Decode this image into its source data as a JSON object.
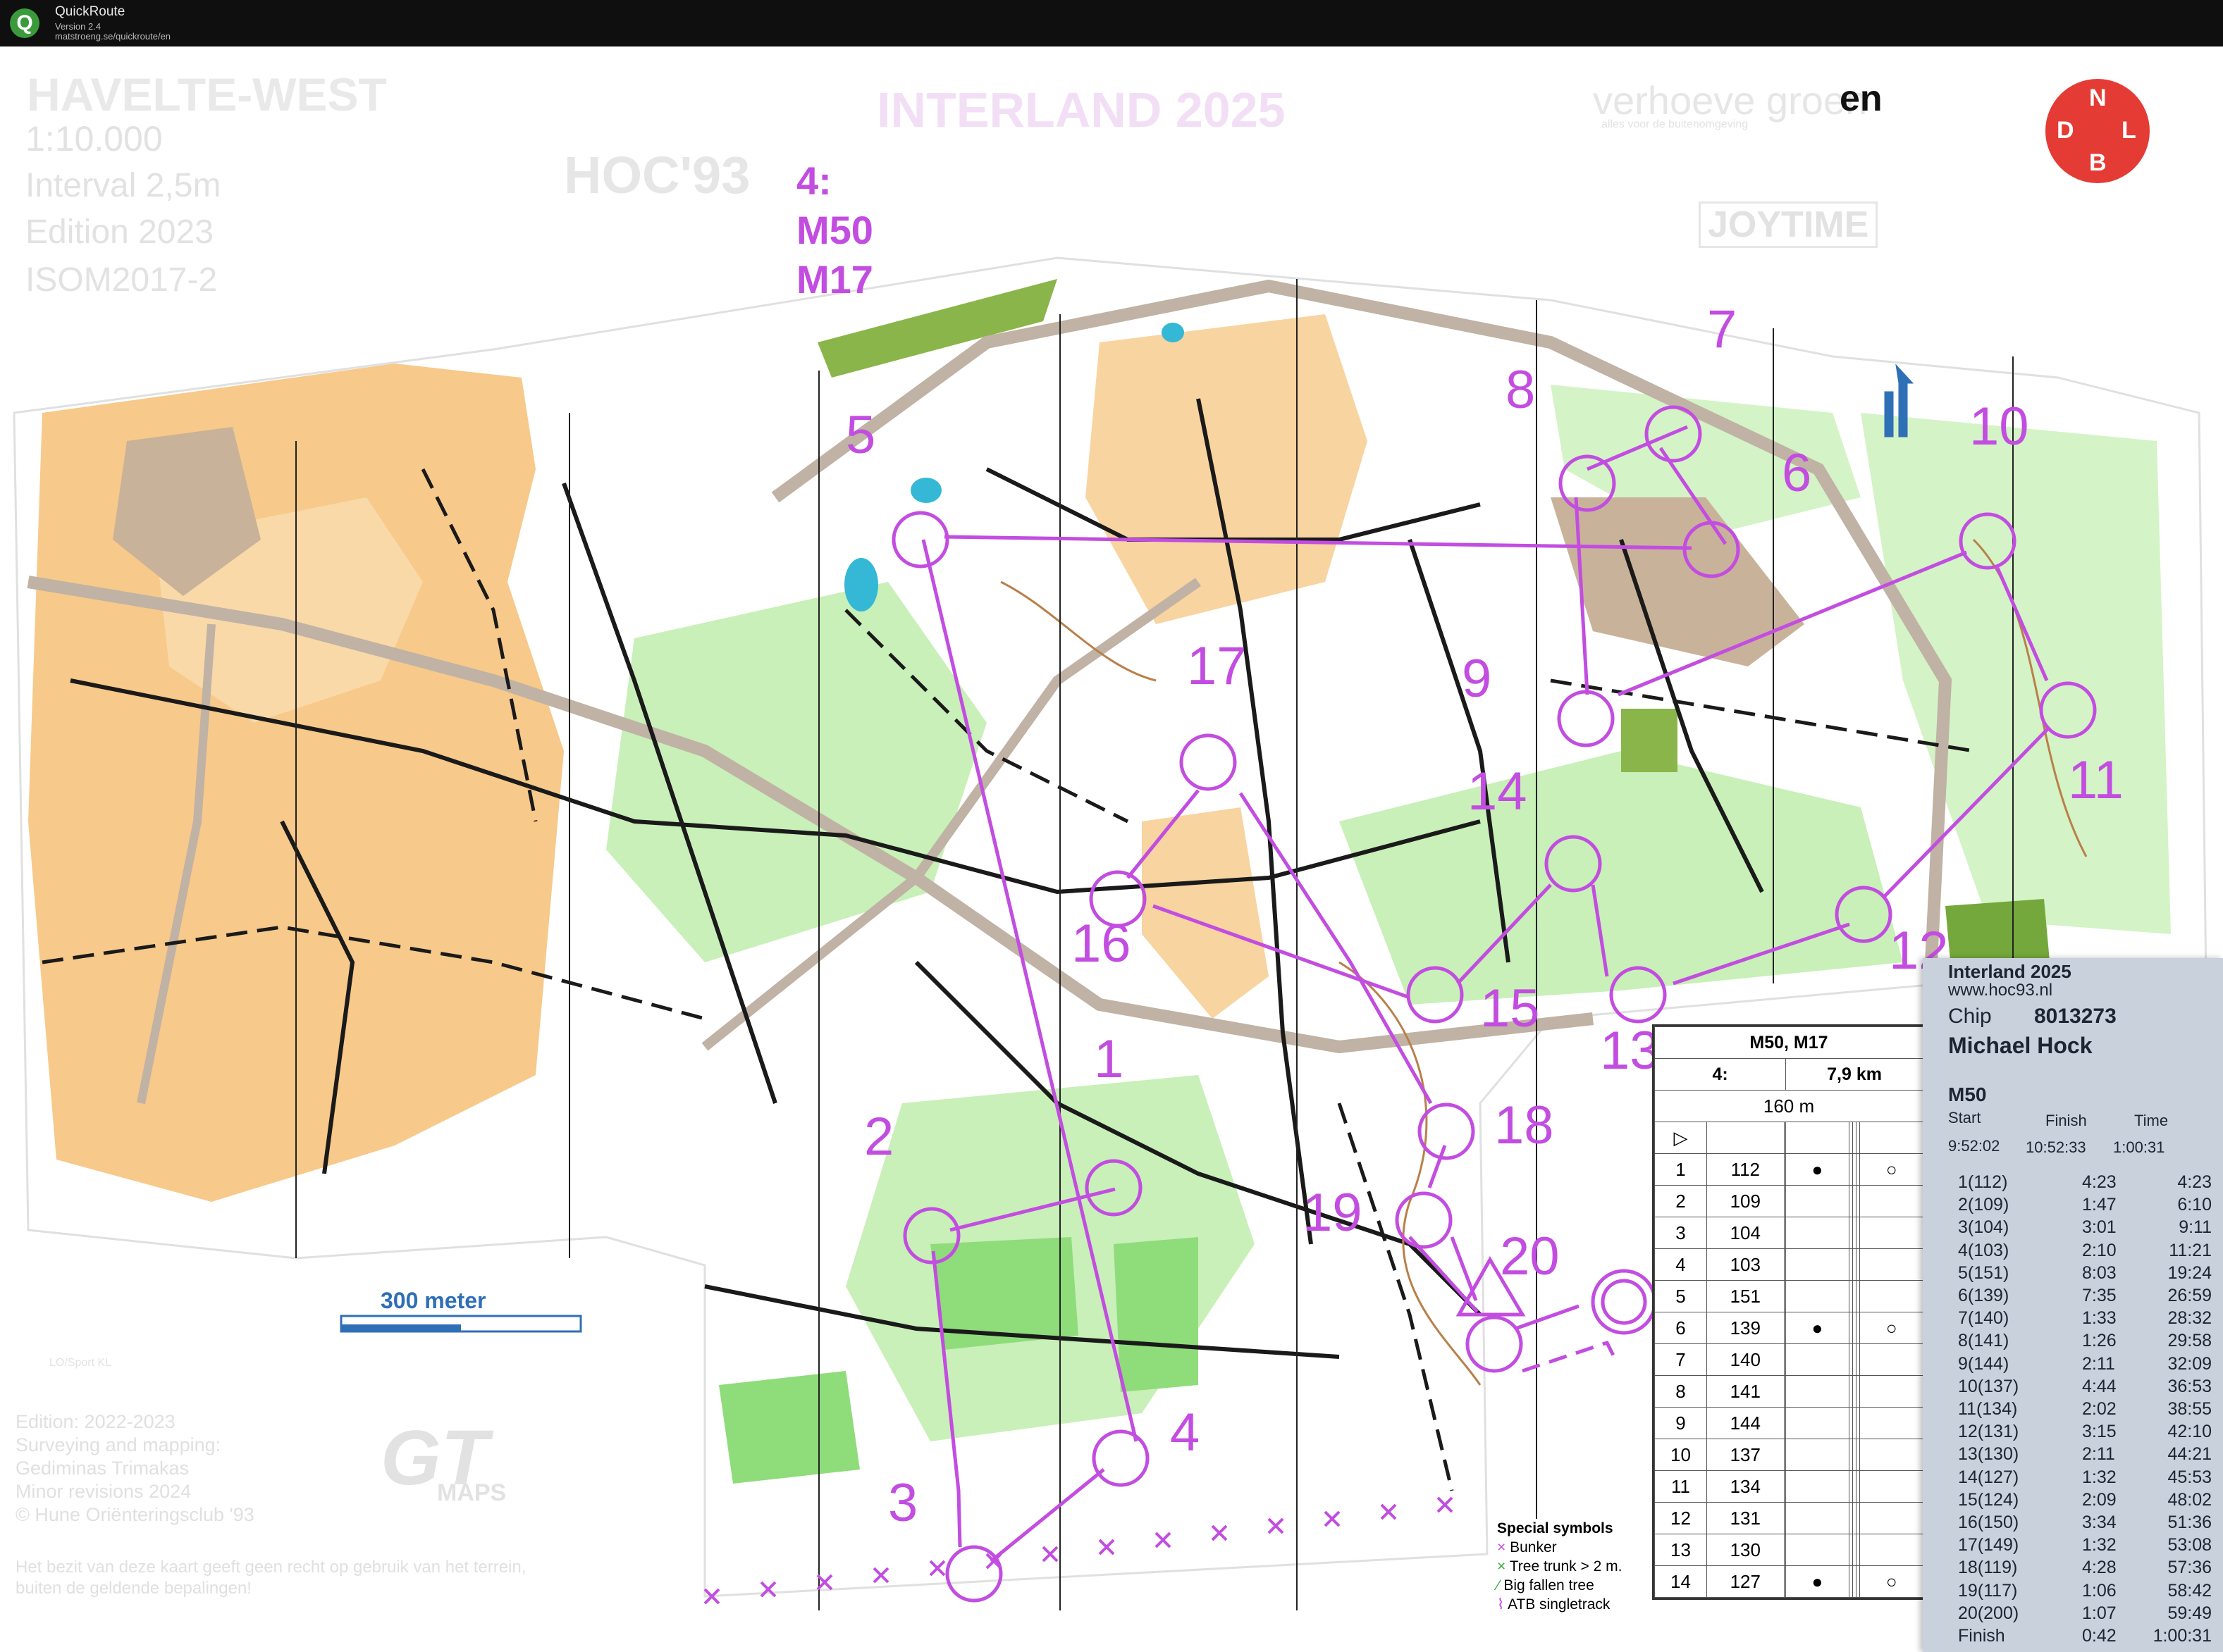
{
  "window": {
    "title": "QuickRoute",
    "version": "Version 2.4",
    "url": "matstroeng.se/quickroute/en"
  },
  "map": {
    "title": "HAVELTE-WEST",
    "scale": "1:10.000",
    "interval": "Interval 2,5m",
    "edition": "Edition 2023",
    "standard": "ISOM2017-2",
    "event_banner": "INTERLAND 2025",
    "sponsor": "verhoeve groen",
    "sponsor_tagline": "alles voor de buitenomgeving",
    "sponsor_suffix": "en",
    "sponsor2": "JOYTIME",
    "club_logo": "HOC'93",
    "class_label": [
      "4:",
      "M50",
      "M17"
    ],
    "scale_bar": "300 meter",
    "footer_lines": [
      "Edition: 2022-2023",
      "Surveying and mapping:",
      "Gediminas Trimakas",
      "Minor revisions 2024",
      "© Hune Oriënteringsclub '93"
    ],
    "disclaimer": [
      "Het bezit van deze kaart geeft geen recht op gebruik van het terrein,",
      "buiten de geldende bepalingen!"
    ],
    "logo_lo": "LO/Sport KL",
    "logo_gt": "GT",
    "logo_gt_sub": "MAPS",
    "flag_letters": [
      "N",
      "L",
      "D",
      "B"
    ],
    "controls": [
      {
        "label": "1"
      },
      {
        "label": "2"
      },
      {
        "label": "3"
      },
      {
        "label": "4"
      },
      {
        "label": "5"
      },
      {
        "label": "6"
      },
      {
        "label": "7"
      },
      {
        "label": "8"
      },
      {
        "label": "9"
      },
      {
        "label": "10"
      },
      {
        "label": "11"
      },
      {
        "label": "12"
      },
      {
        "label": "13"
      },
      {
        "label": "14"
      },
      {
        "label": "15"
      },
      {
        "label": "16"
      },
      {
        "label": "17"
      },
      {
        "label": "18"
      },
      {
        "label": "19"
      },
      {
        "label": "20"
      }
    ],
    "colors": {
      "course": "#c24de0",
      "open": "#f7c98a",
      "forest_green": "#8fdc7a",
      "light_green": "#c8f0b8",
      "track": "#1a1a1a",
      "contour": "#b9804a",
      "paved": "#c9b29a",
      "water": "#35b8d6"
    }
  },
  "description": {
    "classes": "M50, M17",
    "course": "4:",
    "length": "7,9 km",
    "to_finish": "160 m",
    "rows": [
      {
        "n": "1",
        "code": "112"
      },
      {
        "n": "2",
        "code": "109"
      },
      {
        "n": "3",
        "code": "104"
      },
      {
        "n": "4",
        "code": "103"
      },
      {
        "n": "5",
        "code": "151"
      },
      {
        "n": "6",
        "code": "139"
      },
      {
        "n": "7",
        "code": "140"
      },
      {
        "n": "8",
        "code": "141"
      },
      {
        "n": "9",
        "code": "144"
      },
      {
        "n": "10",
        "code": "137"
      },
      {
        "n": "11",
        "code": "134"
      },
      {
        "n": "12",
        "code": "131"
      },
      {
        "n": "13",
        "code": "130"
      },
      {
        "n": "14",
        "code": "127"
      }
    ]
  },
  "special_symbols": {
    "title": "Special symbols",
    "items": [
      "Bunker",
      "Tree trunk > 2 m.",
      "Big fallen tree",
      "ATB singletrack"
    ]
  },
  "receipt": {
    "event": "Interland 2025",
    "website": "www.hoc93.nl",
    "chip_label": "Chip",
    "chip": "8013273",
    "name": "Michael Hock",
    "class": "M50",
    "start_label": "Start",
    "finish_label": "Finish",
    "time_label": "Time",
    "start": "9:52:02",
    "finish": "10:52:33",
    "time": "1:00:31",
    "splits": [
      {
        "c": "1(112)",
        "leg": "4:23",
        "tot": "4:23"
      },
      {
        "c": "2(109)",
        "leg": "1:47",
        "tot": "6:10"
      },
      {
        "c": "3(104)",
        "leg": "3:01",
        "tot": "9:11"
      },
      {
        "c": "4(103)",
        "leg": "2:10",
        "tot": "11:21"
      },
      {
        "c": "5(151)",
        "leg": "8:03",
        "tot": "19:24"
      },
      {
        "c": "6(139)",
        "leg": "7:35",
        "tot": "26:59"
      },
      {
        "c": "7(140)",
        "leg": "1:33",
        "tot": "28:32"
      },
      {
        "c": "8(141)",
        "leg": "1:26",
        "tot": "29:58"
      },
      {
        "c": "9(144)",
        "leg": "2:11",
        "tot": "32:09"
      },
      {
        "c": "10(137)",
        "leg": "4:44",
        "tot": "36:53"
      },
      {
        "c": "11(134)",
        "leg": "2:02",
        "tot": "38:55"
      },
      {
        "c": "12(131)",
        "leg": "3:15",
        "tot": "42:10"
      },
      {
        "c": "13(130)",
        "leg": "2:11",
        "tot": "44:21"
      },
      {
        "c": "14(127)",
        "leg": "1:32",
        "tot": "45:53"
      },
      {
        "c": "15(124)",
        "leg": "2:09",
        "tot": "48:02"
      },
      {
        "c": "16(150)",
        "leg": "3:34",
        "tot": "51:36"
      },
      {
        "c": "17(149)",
        "leg": "1:32",
        "tot": "53:08"
      },
      {
        "c": "18(119)",
        "leg": "4:28",
        "tot": "57:36"
      },
      {
        "c": "19(117)",
        "leg": "1:06",
        "tot": "58:42"
      },
      {
        "c": "20(200)",
        "leg": "1:07",
        "tot": "59:49"
      },
      {
        "c": "Finish",
        "leg": "0:42",
        "tot": "1:00:31"
      }
    ]
  }
}
